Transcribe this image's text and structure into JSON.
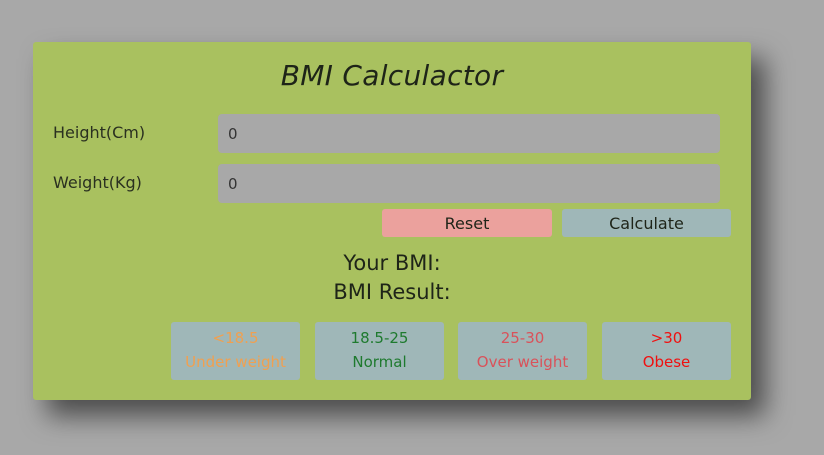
{
  "title": "BMI Calculactor",
  "form": {
    "height_label": "Height(Cm)",
    "height_value": "0",
    "weight_label": "Weight(Kg)",
    "weight_value": "0",
    "reset_label": "Reset",
    "calculate_label": "Calculate"
  },
  "result": {
    "bmi_label": "Your BMI:",
    "result_label": "BMI Result:"
  },
  "categories": [
    {
      "range": "<18.5",
      "name": "Under weight",
      "color": "#f0a050"
    },
    {
      "range": "18.5-25",
      "name": "Normal",
      "color": "#1e7a2e"
    },
    {
      "range": "25-30",
      "name": "Over weight",
      "color": "#d9525a"
    },
    {
      "range": ">30",
      "name": "Obese",
      "color": "#f01010"
    }
  ],
  "colors": {
    "background": "#a8a8a8",
    "card": "#a9c15f",
    "reset_button": "#eba19d",
    "calculate_button": "#9fb7b8",
    "category_box": "#9fb7b8"
  }
}
